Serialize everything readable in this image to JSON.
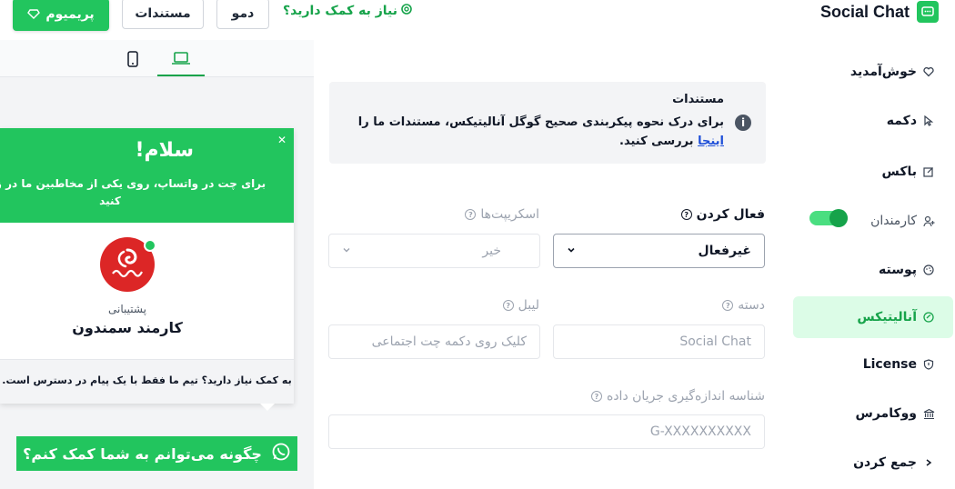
{
  "header": {
    "brand_title": "Social Chat",
    "help_text": "نیاز به کمک دارید؟",
    "demo_label": "دمو",
    "docs_label": "مستندات",
    "premium_label": "پریمیوم"
  },
  "sidebar": {
    "items": [
      {
        "label": "خوش‌آمدید"
      },
      {
        "label": "دکمه"
      },
      {
        "label": "باکس"
      },
      {
        "label": "کارمندان"
      },
      {
        "label": "پوسته"
      },
      {
        "label": "آنالیتیکس"
      },
      {
        "label": "License"
      },
      {
        "label": "ووکامرس"
      },
      {
        "label": "جمع کردن"
      }
    ],
    "active_index": 5,
    "box_toggle_on": true
  },
  "notice": {
    "title": "مستندات",
    "body_before": "برای درک نحوه پیکربندی صحیح گوگل آنالیتیکس، مستندات ما را",
    "link_text": "اینجا",
    "body_after": "بررسی کنید."
  },
  "form": {
    "enable_label": "فعال کردن",
    "enable_value": "غیرفعال",
    "scripts_label": "اسکریپت‌ها",
    "scripts_value": "خیر",
    "category_label": "دسته",
    "category_value": "Social Chat",
    "label_label": "لیبل",
    "label_value": "کلیک روی دکمه چت اجتماعی",
    "stream_label": "شناسه اندازه‌گیری جریان داده",
    "stream_placeholder": "G-XXXXXXXXXX"
  },
  "preview": {
    "chat_title": "سلام!",
    "chat_subtitle": "برای چت در واتساپ، روی یکی از مخاطبین ما در زیر کلیک کنید",
    "agent_role": "پشتیبانی",
    "agent_name": "کارمند سمندون",
    "footer_text": "به کمک نیاز دارید؟ تیم ما فقط با یک پیام در دسترس است.",
    "button_label": "چگونه می‌توانم به شما کمک کنم؟"
  },
  "colors": {
    "accent": "#22c55e",
    "accent_dark": "#16a34a",
    "active_bg": "#dcfce7"
  }
}
